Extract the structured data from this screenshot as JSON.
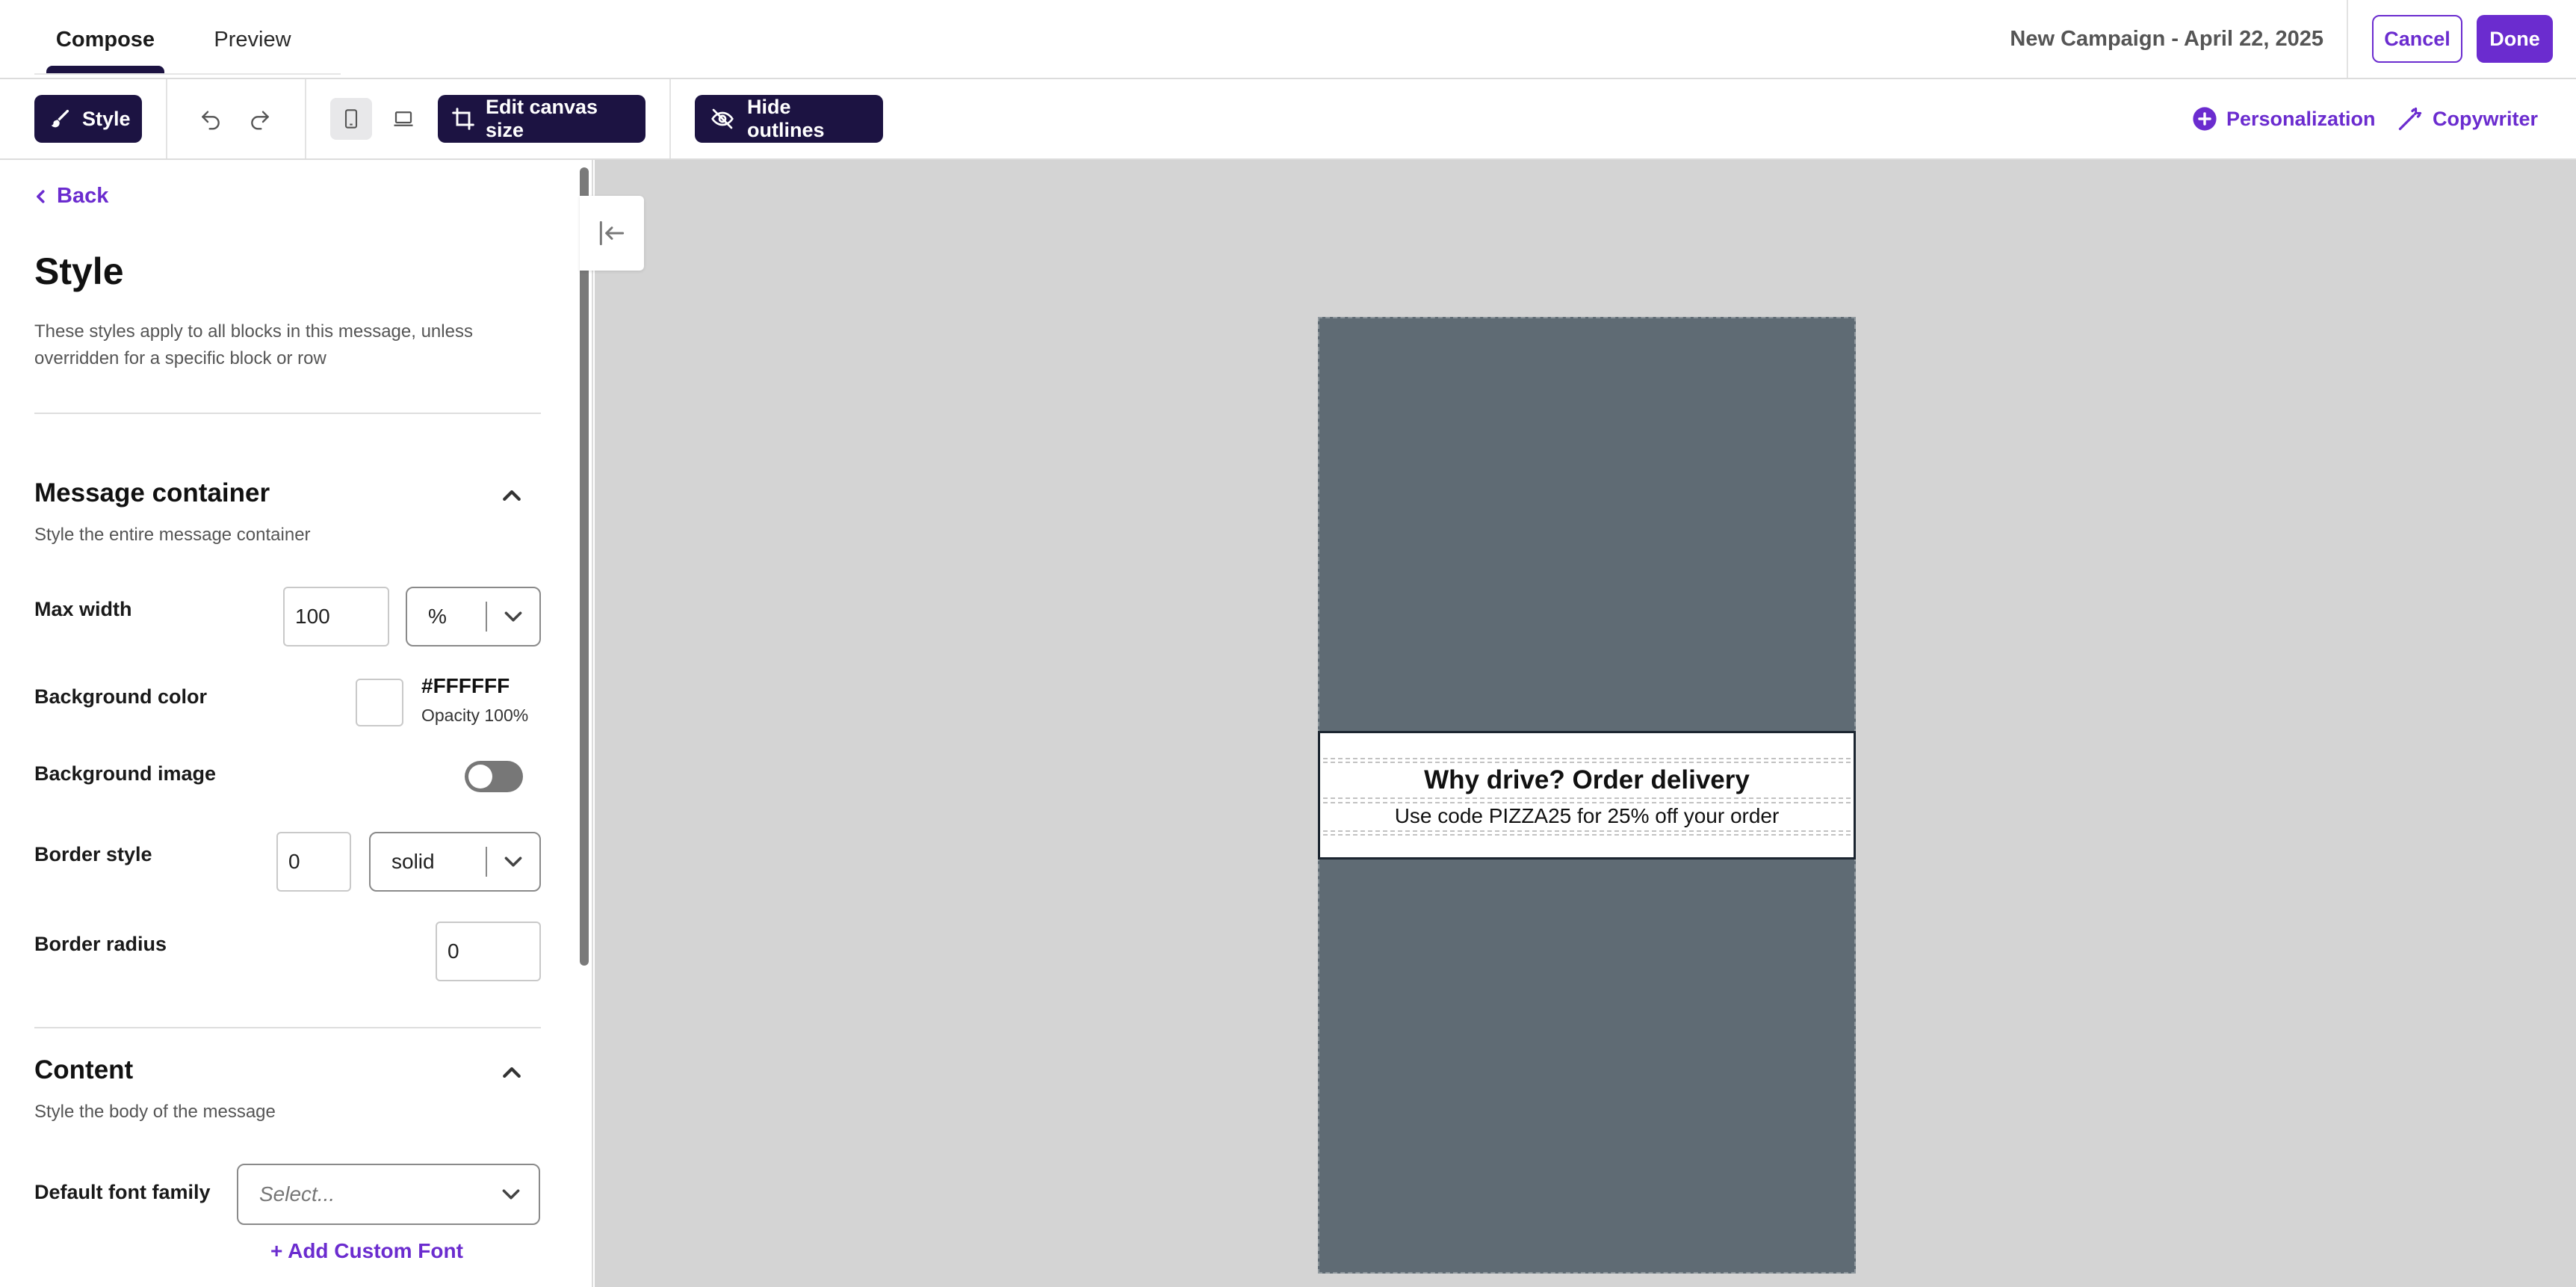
{
  "header": {
    "tabs": [
      {
        "label": "Compose",
        "active": true
      },
      {
        "label": "Preview",
        "active": false
      }
    ],
    "campaign_title": "New Campaign - April 22, 2025",
    "cancel_label": "Cancel",
    "done_label": "Done"
  },
  "toolbar": {
    "style_label": "Style",
    "undo_icon": "undo-icon",
    "redo_icon": "redo-icon",
    "mobile_icon": "mobile-icon",
    "desktop_icon": "desktop-icon",
    "edit_canvas_label": "Edit canvas size",
    "hide_outlines_label": "Hide outlines",
    "personalization_label": "Personalization",
    "copywriter_label": "Copywriter"
  },
  "sidebar": {
    "back_label": "Back",
    "title": "Style",
    "description": "These styles apply to all blocks in this message, unless overridden for a specific block or row",
    "message_container": {
      "title": "Message container",
      "description": "Style the entire message container",
      "max_width_label": "Max width",
      "max_width_value": "100",
      "max_width_unit": "%",
      "background_color_label": "Background color",
      "background_color_hex": "#FFFFFF",
      "background_color_opacity": "Opacity 100%",
      "background_image_label": "Background image",
      "background_image_enabled": false,
      "border_style_label": "Border style",
      "border_width_value": "0",
      "border_style_value": "solid",
      "border_radius_label": "Border radius",
      "border_radius_value": "0"
    },
    "content": {
      "title": "Content",
      "description": "Style the body of the message",
      "default_font_label": "Default font family",
      "default_font_placeholder": "Select...",
      "add_custom_font_label": "+ Add Custom Font"
    }
  },
  "canvas": {
    "background_color": "#d4d4d4",
    "frame_color": "#5f6b74",
    "message": {
      "headline": "Why drive? Order delivery",
      "subtext": "Use code PIZZA25 for 25% off your order"
    }
  },
  "colors": {
    "accent": "#6b2ccf",
    "dark": "#1c1342"
  }
}
